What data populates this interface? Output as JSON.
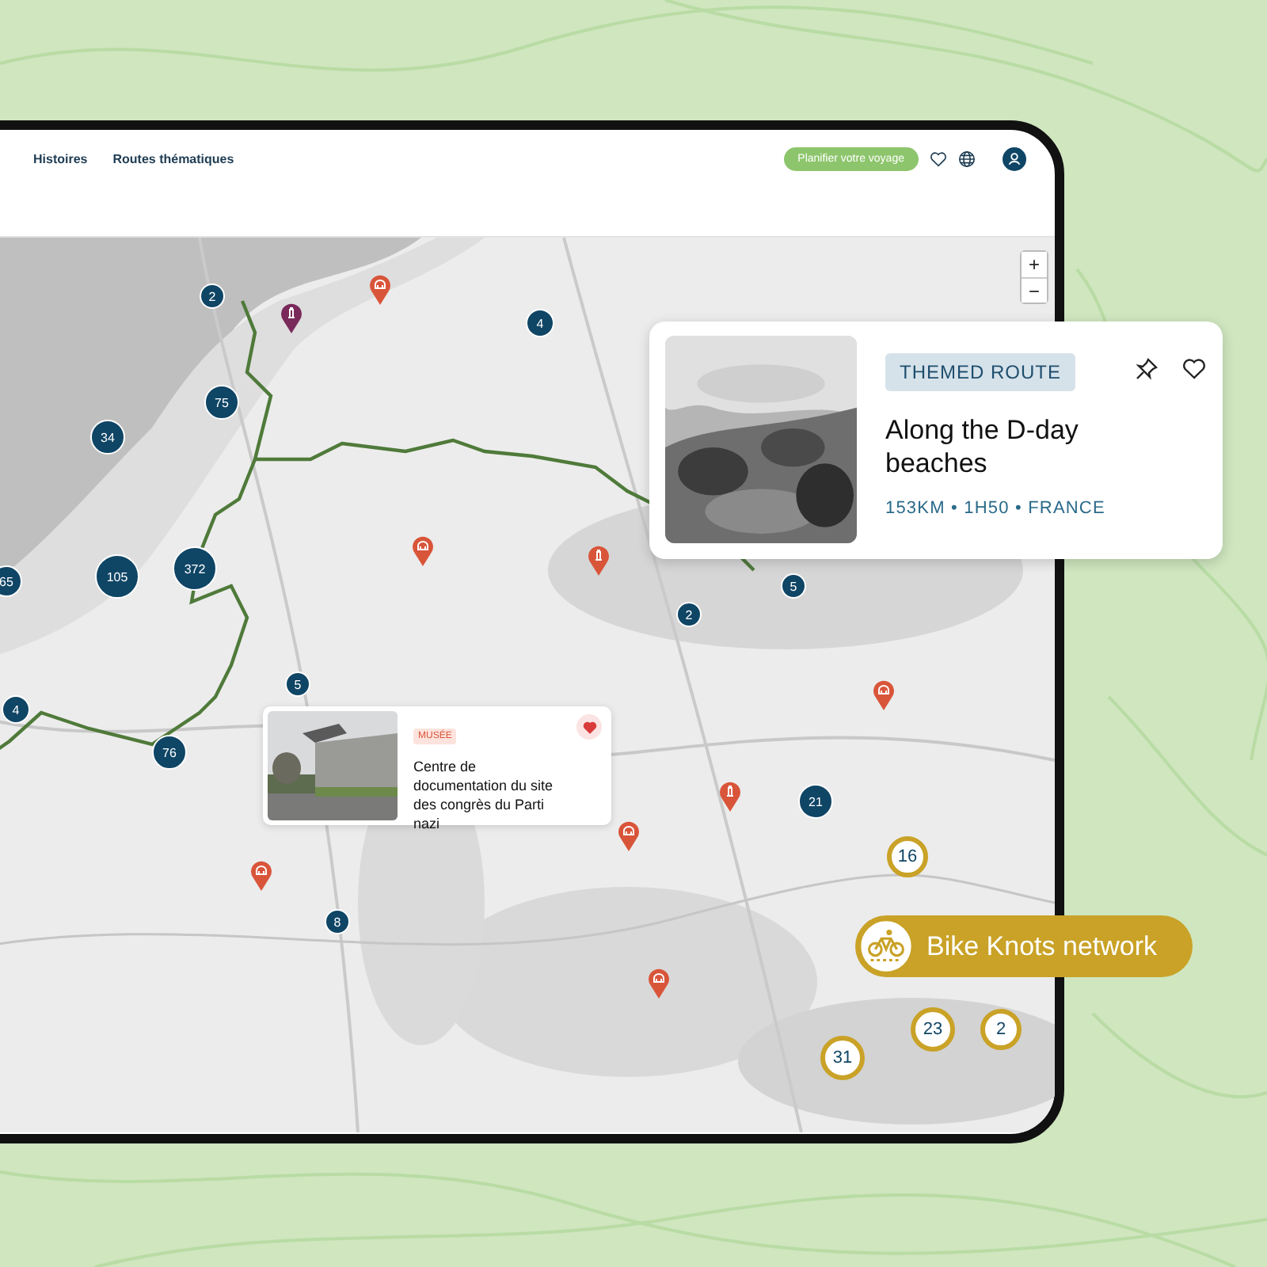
{
  "header": {
    "nav": [
      {
        "label": "Histoires"
      },
      {
        "label": "Routes thématiques"
      }
    ],
    "cta": "Planifier votre voyage"
  },
  "map": {
    "zoom_in": "+",
    "zoom_out": "−",
    "clusters": [
      {
        "count": "2",
        "kind": "story"
      },
      {
        "count": "4",
        "kind": "story"
      },
      {
        "count": "75",
        "kind": "story"
      },
      {
        "count": "34",
        "kind": "story"
      },
      {
        "count": "105",
        "kind": "story"
      },
      {
        "count": "372",
        "kind": "story"
      },
      {
        "count": "65",
        "kind": "story"
      },
      {
        "count": "4",
        "kind": "story"
      },
      {
        "count": "5",
        "kind": "story"
      },
      {
        "count": "76",
        "kind": "story"
      },
      {
        "count": "8",
        "kind": "story"
      },
      {
        "count": "2",
        "kind": "story"
      },
      {
        "count": "5",
        "kind": "story"
      },
      {
        "count": "21",
        "kind": "story"
      },
      {
        "count": "16",
        "kind": "knot"
      },
      {
        "count": "31",
        "kind": "knot"
      },
      {
        "count": "23",
        "kind": "knot"
      },
      {
        "count": "2",
        "kind": "knot"
      }
    ],
    "pins": [
      {
        "kind": "building",
        "color": "#d9553a"
      },
      {
        "kind": "building",
        "color": "#d9553a"
      },
      {
        "kind": "tower",
        "color": "#d9553a"
      },
      {
        "kind": "tower",
        "color": "#d9553a"
      },
      {
        "kind": "building",
        "color": "#d9553a"
      },
      {
        "kind": "building",
        "color": "#d9553a"
      },
      {
        "kind": "building",
        "color": "#d9553a"
      },
      {
        "kind": "building",
        "color": "#d9553a"
      },
      {
        "kind": "tower",
        "color": "#7a2a5a"
      }
    ]
  },
  "route_card": {
    "tag": "THEMED ROUTE",
    "title": "Along the D-day beaches",
    "meta": "153KM • 1H50 • FRANCE",
    "pinned": false,
    "favorite": false
  },
  "place_card": {
    "tag": "MUSÉE",
    "title": "Centre de documentation du site des congrès du Parti nazi",
    "favorite": true
  },
  "legend": {
    "label": "Bike Knots network"
  }
}
